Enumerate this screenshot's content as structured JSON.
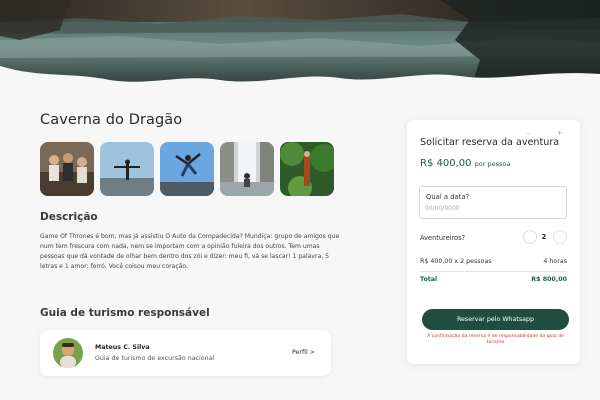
{
  "page": {
    "title": "Caverna do Dragão"
  },
  "gallery": {
    "photos": [
      "group-photo",
      "person-arms-open-photo",
      "person-jumping-photo",
      "waterfall-photo",
      "forest-photo"
    ]
  },
  "description": {
    "heading": "Descrição",
    "text": "Game Of Thrones é bom, mas já assistiu O Auto da Compadecida? Mundiça: grupo de amigos que num tem frescura com nada, nem se importam com a opinião fuleira dos outros. Tem umas pessoas que dá vontade de olhar bem dentro dos zói e dizer: meu fi, vá se lascar! 1 palavra, 5 letras e 1 amor: forró. Você coisou meu coração."
  },
  "guide": {
    "heading": "Guia de turismo responsável",
    "name": "Mateus C. Silva",
    "role": "Guia de turismo de excursão nacional",
    "profile_label": "Perfil >"
  },
  "booking": {
    "title": "Solicitar reserva da aventura",
    "minimize_label": "–",
    "expand_label": "+",
    "price": "R$ 400,00",
    "price_unit": "por pessoa",
    "date_label": "Qual a data?",
    "date_placeholder": "00/00/0000",
    "adventurers_label": "Aventureiros?",
    "adventurers_count": "2",
    "calc_label": "R$ 400,00 x 2 pessoas",
    "calc_value": "4 horas",
    "total_label": "Total",
    "total_value": "R$ 800,00",
    "button_label": "Reservar pelo Whatsapp",
    "note": "A confirmação da reserva é de responsabilidade do guia de turismo"
  },
  "colors": {
    "accent": "#1f4d40",
    "price": "#1d5c49",
    "note": "#c0392b"
  }
}
